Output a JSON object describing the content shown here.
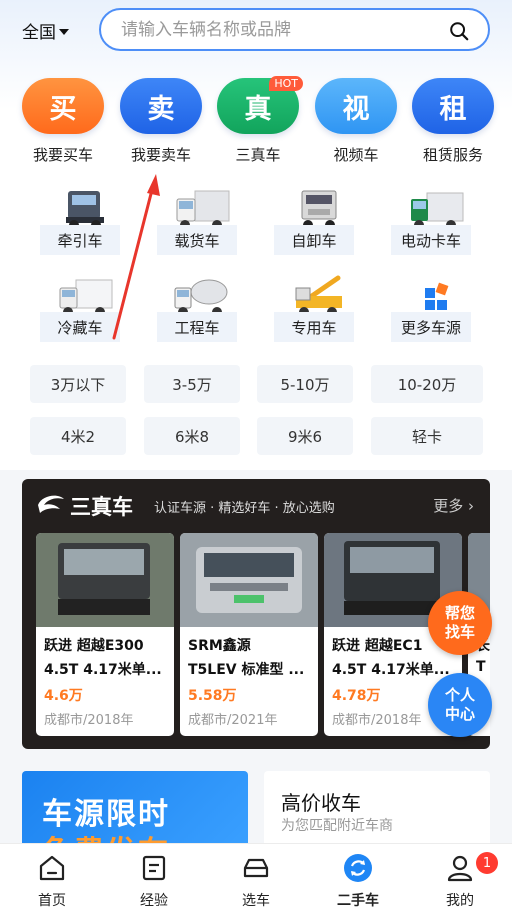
{
  "header": {
    "city": "全国",
    "search_placeholder": "请输入车辆名称或品牌"
  },
  "categories": [
    {
      "glyph": "买",
      "label": "我要买车",
      "color": "#ff7a22"
    },
    {
      "glyph": "卖",
      "label": "我要卖车",
      "color": "#2a73f0"
    },
    {
      "glyph": "真",
      "label": "三真车",
      "color": "#18b46a",
      "badge": "HOT"
    },
    {
      "glyph": "视",
      "label": "视频车",
      "color": "#3fa3f7"
    },
    {
      "glyph": "租",
      "label": "租赁服务",
      "color": "#2a73f0"
    }
  ],
  "vehicle_types": [
    {
      "label": "牵引车",
      "icon": "tractor-truck-icon"
    },
    {
      "label": "载货车",
      "icon": "cargo-truck-icon"
    },
    {
      "label": "自卸车",
      "icon": "dump-truck-icon"
    },
    {
      "label": "电动卡车",
      "icon": "electric-truck-icon"
    },
    {
      "label": "冷藏车",
      "icon": "refrigerated-truck-icon"
    },
    {
      "label": "工程车",
      "icon": "mixer-truck-icon"
    },
    {
      "label": "专用车",
      "icon": "crane-truck-icon"
    },
    {
      "label": "更多车源",
      "icon": "more-grid-icon"
    }
  ],
  "price_chips": [
    "3万以下",
    "3-5万",
    "5-10万",
    "10-20万"
  ],
  "length_chips": [
    "4米2",
    "6米8",
    "9米6",
    "轻卡"
  ],
  "sanzhen": {
    "title": "三真车",
    "subtitle": "认证车源 · 精选好车 · 放心选购",
    "more": "更多",
    "cards": [
      {
        "name": "跃进 超越E300",
        "spec": "4.5T 4.17米单...",
        "price": "4.6万",
        "meta": "成都市/2018年"
      },
      {
        "name": "SRM鑫源",
        "spec": "T5LEV 标准型 ...",
        "price": "5.58万",
        "meta": "成都市/2021年"
      },
      {
        "name": "跃进 超越EC1",
        "spec": "4.5T 4.17米单...",
        "price": "4.78万",
        "meta": "成都市/2018年"
      },
      {
        "name": "长",
        "spec": "T",
        "price": "",
        "meta": ""
      }
    ]
  },
  "float_buttons": {
    "find_car": "帮您找车",
    "personal": "个人中心"
  },
  "promo": {
    "left_line1": "车源限时",
    "left_line2": "免费发布",
    "right_title": "高价收车",
    "right_sub": "为您匹配附近车商"
  },
  "tabbar": [
    {
      "label": "首页",
      "icon": "home-icon"
    },
    {
      "label": "经验",
      "icon": "notebook-icon"
    },
    {
      "label": "选车",
      "icon": "car-select-icon"
    },
    {
      "label": "二手车",
      "icon": "used-car-icon",
      "active": true
    },
    {
      "label": "我的",
      "icon": "user-icon",
      "badge": "1"
    }
  ],
  "colors": {
    "accent": "#2a73f0",
    "price": "#ff7a22",
    "annotation_arrow": "#e8362c"
  }
}
